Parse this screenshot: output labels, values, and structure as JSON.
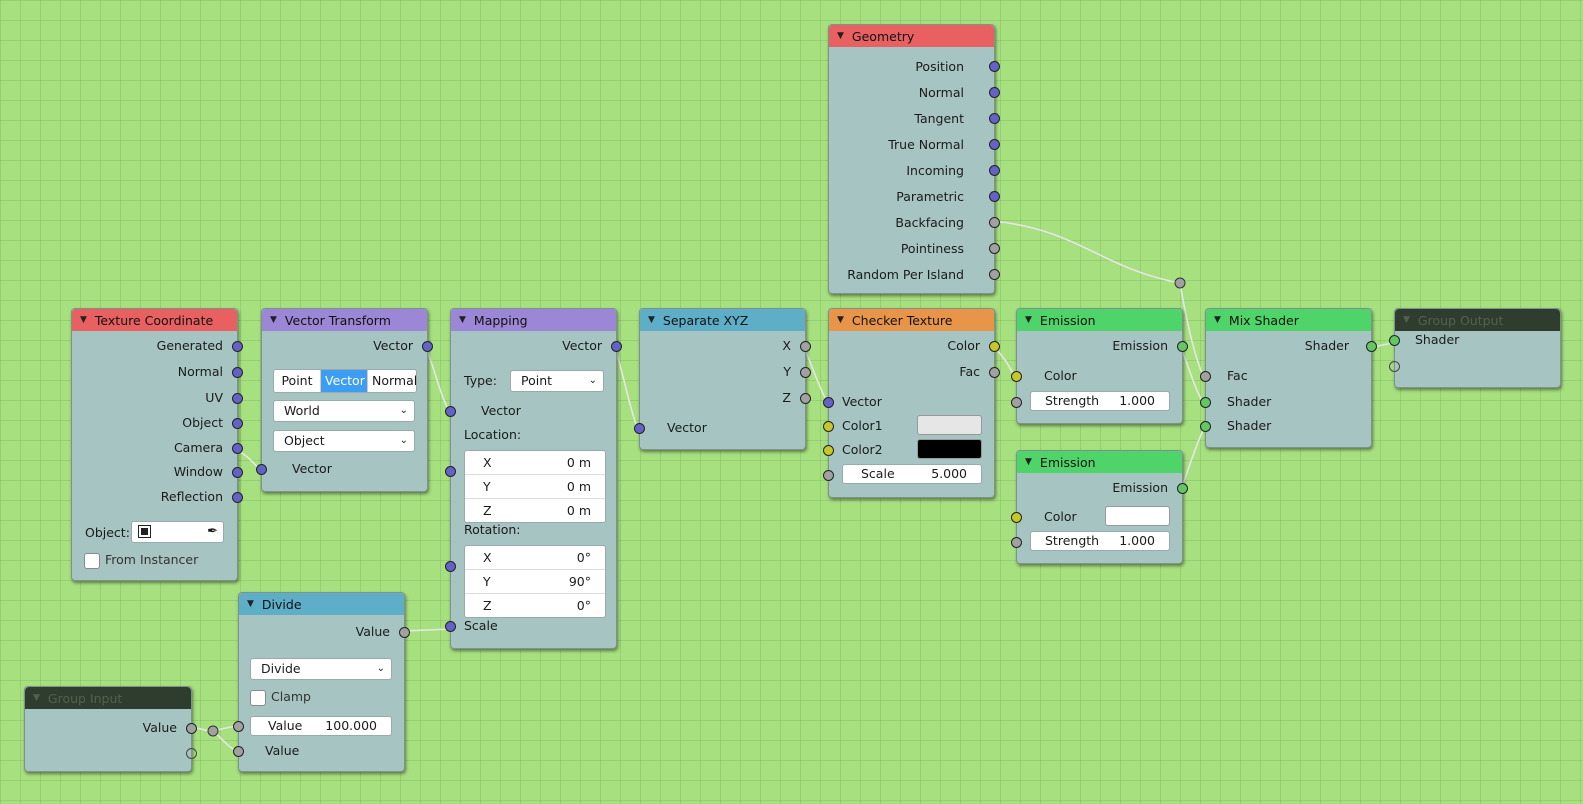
{
  "geometry": {
    "title": "Geometry",
    "outputs": [
      "Position",
      "Normal",
      "Tangent",
      "True Normal",
      "Incoming",
      "Parametric",
      "Backfacing",
      "Pointiness",
      "Random Per Island"
    ]
  },
  "texcoord": {
    "title": "Texture Coordinate",
    "outputs": [
      "Generated",
      "Normal",
      "UV",
      "Object",
      "Camera",
      "Window",
      "Reflection"
    ],
    "object_label": "Object:",
    "from_instancer": "From Instancer"
  },
  "vectortransform": {
    "title": "Vector Transform",
    "out": "Vector",
    "seg": [
      "Point",
      "Vector",
      "Normal"
    ],
    "convert_from": "World",
    "convert_to": "Object",
    "in": "Vector"
  },
  "mapping": {
    "title": "Mapping",
    "out": "Vector",
    "type_label": "Type:",
    "type_value": "Point",
    "in_vector": "Vector",
    "location_label": "Location:",
    "location": [
      {
        "axis": "X",
        "value": "0 m"
      },
      {
        "axis": "Y",
        "value": "0 m"
      },
      {
        "axis": "Z",
        "value": "0 m"
      }
    ],
    "rotation_label": "Rotation:",
    "rotation": [
      {
        "axis": "X",
        "value": "0°"
      },
      {
        "axis": "Y",
        "value": "90°"
      },
      {
        "axis": "Z",
        "value": "0°"
      }
    ],
    "scale": "Scale"
  },
  "separatexyz": {
    "title": "Separate XYZ",
    "outputs": [
      "X",
      "Y",
      "Z"
    ],
    "in": "Vector"
  },
  "checker": {
    "title": "Checker Texture",
    "outputs": [
      "Color",
      "Fac"
    ],
    "in_vector": "Vector",
    "color1": "Color1",
    "color2": "Color2",
    "scale_label": "Scale",
    "scale_value": "5.000"
  },
  "emission1": {
    "title": "Emission",
    "out": "Emission",
    "color": "Color",
    "strength_label": "Strength",
    "strength_value": "1.000"
  },
  "emission2": {
    "title": "Emission",
    "out": "Emission",
    "color": "Color",
    "strength_label": "Strength",
    "strength_value": "1.000"
  },
  "mixshader": {
    "title": "Mix Shader",
    "out": "Shader",
    "inputs": [
      "Fac",
      "Shader",
      "Shader"
    ]
  },
  "groupoutput": {
    "title": "Group Output",
    "in": "Shader"
  },
  "divide": {
    "title": "Divide",
    "out": "Value",
    "op": "Divide",
    "clamp": "Clamp",
    "value_label": "Value",
    "value_value": "100.000",
    "in": "Value"
  },
  "groupinput": {
    "title": "Group Input",
    "out": "Value"
  },
  "colors": {
    "vector_socket": "#6363c7",
    "float_socket": "#a1a1a1",
    "color_socket": "#c7c729",
    "shader_socket": "#63c763",
    "background": "#a6e07f",
    "node_body": "#a6c4c1"
  }
}
